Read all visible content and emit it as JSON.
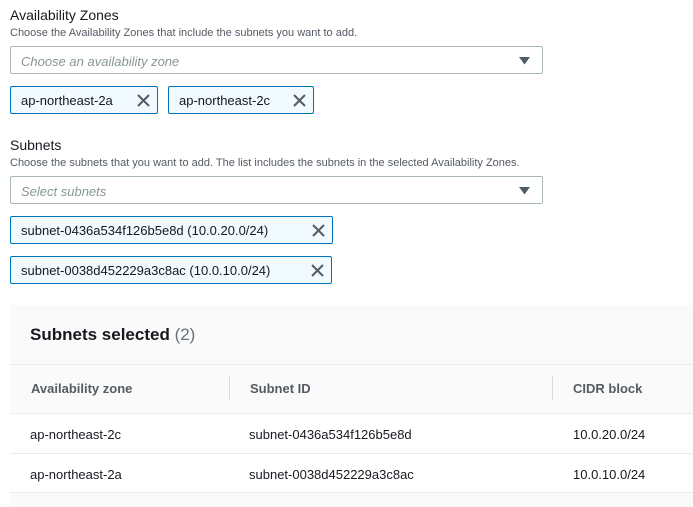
{
  "availability_zones": {
    "label": "Availability Zones",
    "description": "Choose the Availability Zones that include the subnets you want to add.",
    "placeholder": "Choose an availability zone",
    "tokens": [
      {
        "label": "ap-northeast-2a"
      },
      {
        "label": "ap-northeast-2c"
      }
    ]
  },
  "subnets": {
    "label": "Subnets",
    "description": "Choose the subnets that you want to add. The list includes the subnets in the selected Availability Zones.",
    "placeholder": "Select subnets",
    "tokens": [
      {
        "label": "subnet-0436a534f126b5e8d (10.0.20.0/24)"
      },
      {
        "label": "subnet-0038d452229a3c8ac (10.0.10.0/24)"
      }
    ]
  },
  "selected_panel": {
    "title": "Subnets selected",
    "count": "(2)",
    "columns": [
      "Availability zone",
      "Subnet ID",
      "CIDR block"
    ],
    "rows": [
      {
        "az": "ap-northeast-2c",
        "subnet_id": "subnet-0436a534f126b5e8d",
        "cidr": "10.0.20.0/24"
      },
      {
        "az": "ap-northeast-2a",
        "subnet_id": "subnet-0038d452229a3c8ac",
        "cidr": "10.0.10.0/24"
      }
    ]
  },
  "colors": {
    "token_border": "#0073bb",
    "token_background": "#f1faff",
    "panel_background": "#fafafa"
  },
  "icons": {
    "caret": "caret-down-icon",
    "remove": "close-icon"
  }
}
